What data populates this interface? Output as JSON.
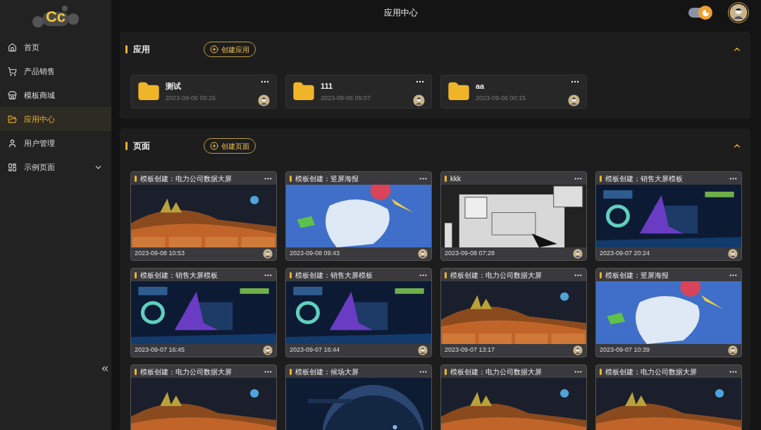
{
  "logo": {
    "text": "Cc"
  },
  "sidebar": {
    "items": [
      {
        "label": "首页",
        "kind": "link",
        "selected": false
      },
      {
        "label": "产品销售",
        "kind": "link",
        "selected": false
      },
      {
        "label": "模板商城",
        "kind": "link",
        "selected": false
      },
      {
        "label": "应用中心",
        "kind": "link",
        "selected": true
      },
      {
        "label": "用户管理",
        "kind": "link",
        "selected": false
      },
      {
        "label": "示例页面",
        "kind": "group",
        "selected": false,
        "expanded": false
      }
    ]
  },
  "header": {
    "title": "应用中心",
    "theme_toggle": {
      "on": true
    }
  },
  "apps_section": {
    "title": "应用",
    "create_button": "创建应用",
    "expanded": true,
    "cards": [
      {
        "name": "测试",
        "date": "2023-09-06 09:26"
      },
      {
        "name": "111",
        "date": "2023-09-06 09:07"
      },
      {
        "name": "aa",
        "date": "2023-09-06 00:15"
      }
    ]
  },
  "pages_section": {
    "title": "页面",
    "create_button": "创建页面",
    "expanded": true,
    "cards": [
      {
        "title": "模板创建：电力公司数据大屏",
        "date": "2023-09-08 10:53"
      },
      {
        "title": "模板创建：竖屏海报",
        "date": "2023-09-08 09:43"
      },
      {
        "title": "kkk",
        "date": "2023-09-08 07:28"
      },
      {
        "title": "模板创建：销售大屏模板",
        "date": "2023-09-07 20:24"
      },
      {
        "title": "模板创建：销售大屏模板",
        "date": "2023-09-07 16:45"
      },
      {
        "title": "模板创建：销售大屏模板",
        "date": "2023-09-07 16:44"
      },
      {
        "title": "模板创建：电力公司数据大屏",
        "date": "2023-09-07 13:17"
      },
      {
        "title": "模板创建：竖屏海报",
        "date": "2023-09-07 10:39"
      },
      {
        "title": "模板创建：电力公司数据大屏"
      },
      {
        "title": "模板创建：候场大屏"
      },
      {
        "title": "模板创建：电力公司数据大屏"
      },
      {
        "title": "模板创建：电力公司数据大屏"
      }
    ]
  }
}
